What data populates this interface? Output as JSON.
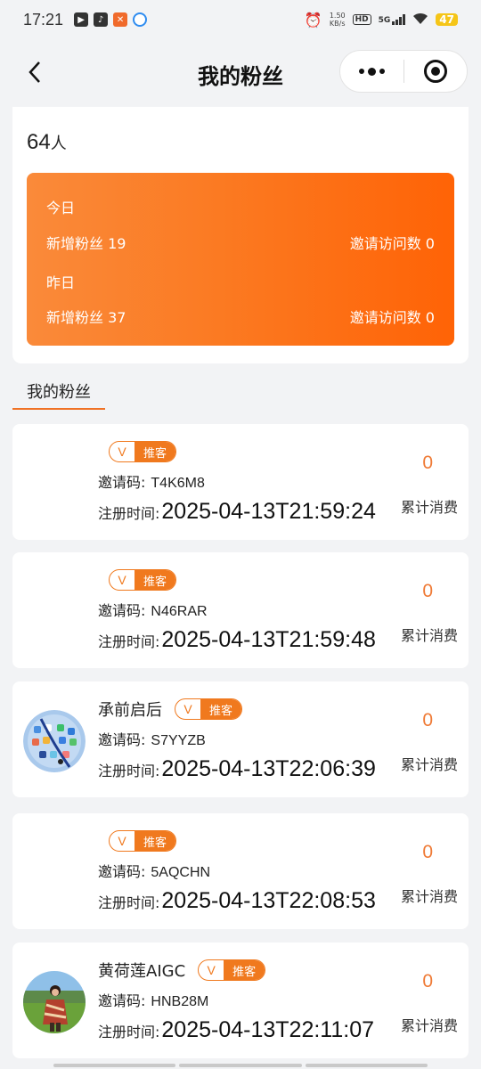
{
  "status_bar": {
    "time": "17:21",
    "speed_top": "1.50",
    "speed_bottom": "KB/s",
    "hd": "HD",
    "network": "5G",
    "battery": "47"
  },
  "nav": {
    "title": "我的粉丝"
  },
  "summary": {
    "total": "64",
    "total_unit": "人",
    "today_label": "今日",
    "today_new_fans": "新增粉丝 19",
    "today_invite_visits": "邀请访问数 0",
    "yesterday_label": "昨日",
    "yesterday_new_fans": "新增粉丝 37",
    "yesterday_invite_visits": "邀请访问数 0",
    "gradient_start": "#fa8a3a",
    "gradient_end": "#ff6306"
  },
  "section_tab": "我的粉丝",
  "labels": {
    "badge_v": "V",
    "badge_text": "推客",
    "invite_code": "邀请码:",
    "reg_time": "注册时间:",
    "total_spend": "累计消费"
  },
  "fans": [
    {
      "name": "",
      "code": "T4K6M8",
      "time": "2025-04-13T21:59:24",
      "spend": "0",
      "avatar": "none"
    },
    {
      "name": "",
      "code": "N46RAR",
      "time": "2025-04-13T21:59:48",
      "spend": "0",
      "avatar": "none"
    },
    {
      "name": "承前启后",
      "code": "S7YYZB",
      "time": "2025-04-13T22:06:39",
      "spend": "0",
      "avatar": "phone-homescreen"
    },
    {
      "name": "",
      "code": "5AQCHN",
      "time": "2025-04-13T22:08:53",
      "spend": "0",
      "avatar": "none"
    },
    {
      "name": "黄荷莲AIGC",
      "code": "HNB28M",
      "time": "2025-04-13T22:11:07",
      "spend": "0",
      "avatar": "person-landscape"
    }
  ],
  "accent_color": "#f0791e"
}
